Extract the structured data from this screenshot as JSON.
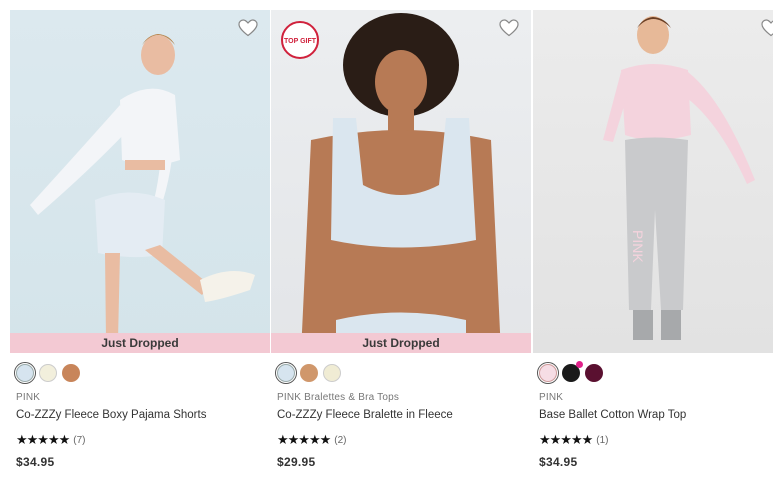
{
  "products": [
    {
      "banner": "Just Dropped",
      "badge": "",
      "swatches": [
        "#d6e4ef",
        "#f2efdc",
        "#c8855a"
      ],
      "brand": "PINK",
      "name": "Co-ZZZy Fleece Boxy Pajama Shorts",
      "stars": "★★★★★",
      "reviews": "(7)",
      "rating": 5,
      "price": "$34.95"
    },
    {
      "banner": "Just Dropped",
      "badge": "TOP GIFT",
      "swatches": [
        "#d6e4ef",
        "#d0976b",
        "#f0ecd4"
      ],
      "brand": "PINK Bralettes & Bra Tops",
      "name": "Co-ZZZy Fleece Bralette in Fleece",
      "stars": "★★★★★",
      "reviews": "(2)",
      "rating": 5,
      "price": "$29.95"
    },
    {
      "banner": "",
      "badge": "",
      "swatches": [
        "#f6dde5",
        "#1a1a1a",
        "#5a1030"
      ],
      "brand": "PINK",
      "name": "Base Ballet Cotton Wrap Top",
      "stars": "★★★★★",
      "reviews": "(1)",
      "rating": 5,
      "price": "$34.95"
    }
  ],
  "icons": {
    "favorite": "heart-outline-icon",
    "rating": "star-icon"
  }
}
